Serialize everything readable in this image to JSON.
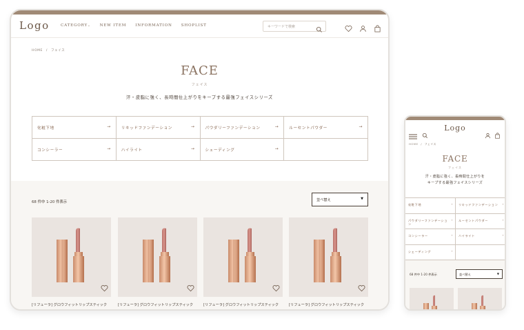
{
  "brand": {
    "logo_text": "Logo",
    "accent_color": "#a08a76",
    "title_color": "#8a7260"
  },
  "nav": {
    "items": [
      "CATEGORY",
      "NEW ITEM",
      "INFORMATION",
      "SHOPLIST"
    ],
    "search_placeholder": "キーワードで検索"
  },
  "breadcrumb": {
    "home": "HOME",
    "sep": "/",
    "current": "フェイス"
  },
  "page": {
    "title": "FACE",
    "subtitle": "フェイス",
    "lead": "汗・皮脂に強く、長時間仕上がりをキープする最強フェイスシリーズ",
    "lead_mobile_1": "汗・皮脂に強く、長時間仕上がりを",
    "lead_mobile_2": "キープする最強フェイスシリーズ"
  },
  "categories": [
    {
      "label": "化粧下地"
    },
    {
      "label": "リキッドファンデーション"
    },
    {
      "label": "パウダリーファンデーション"
    },
    {
      "label": "ルーセントパウダー"
    },
    {
      "label": "コンシーラー"
    },
    {
      "label": "ハイライト"
    },
    {
      "label": "シェーディング"
    },
    {
      "label": ""
    }
  ],
  "arrow": "→",
  "listing": {
    "count_text": "68 件中 1-20 件表示",
    "sort_label": "並べ替え",
    "sort_caret": "▼"
  },
  "products": [
    {
      "name": "[リフューラ] グロウフィットリップスティック"
    },
    {
      "name": "[リフューラ] グロウフィットリップスティック"
    },
    {
      "name": "[リフューラ] グロウフィットリップスティック"
    },
    {
      "name": "[リフューラ] グロウフィットリップスティック"
    }
  ],
  "icons": {
    "search": "search-icon",
    "favorite": "heart-icon",
    "account": "user-icon",
    "cart": "bag-icon",
    "menu": "hamburger-icon"
  }
}
